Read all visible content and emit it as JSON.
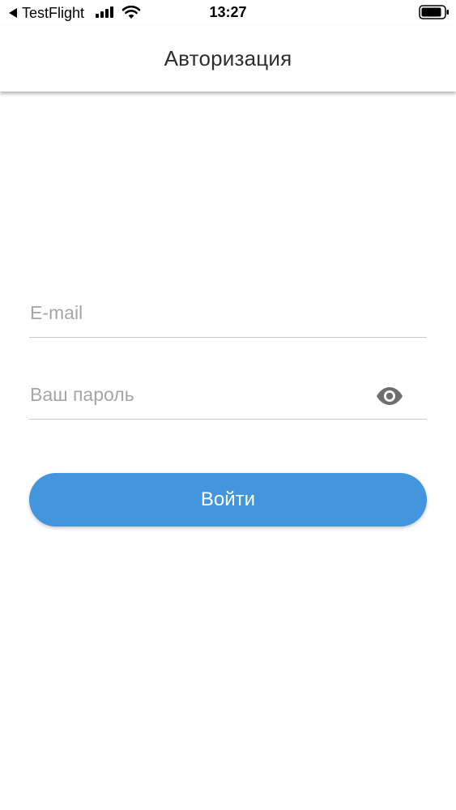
{
  "status_bar": {
    "back_app": "TestFlight",
    "time": "13:27",
    "icons": [
      "signal-icon",
      "wifi-icon",
      "battery-icon"
    ]
  },
  "header": {
    "title": "Авторизация"
  },
  "form": {
    "email_placeholder": "E-mail",
    "email_value": "",
    "password_placeholder": "Ваш пароль",
    "password_value": "",
    "password_toggle_icon": "eye-icon",
    "submit_label": "Войти"
  },
  "colors": {
    "accent": "#4396dd",
    "title_text": "#2e2e2e",
    "placeholder": "#a6a6a6",
    "divider": "#c8c8c8",
    "icon": "#6e6e6e"
  }
}
